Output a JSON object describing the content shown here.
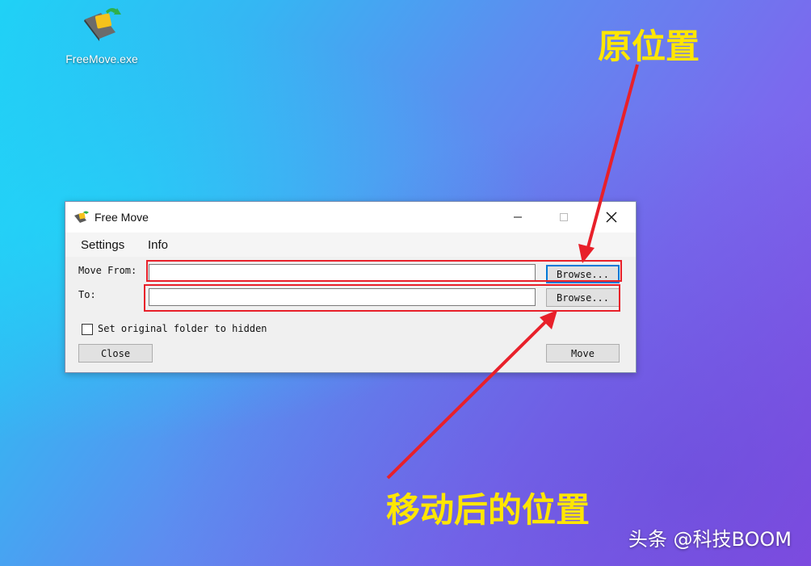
{
  "desktop": {
    "icon_label": "FreeMove.exe"
  },
  "window": {
    "title": "Free Move",
    "menu": [
      "Settings",
      "Info"
    ],
    "move_from_label": "Move From:",
    "move_from_value": "",
    "to_label": "To:",
    "to_value": "",
    "browse_label": "Browse...",
    "checkbox_label": "Set original folder to hidden",
    "checkbox_checked": false,
    "close_label": "Close",
    "move_label": "Move"
  },
  "annotations": {
    "original_location": "原位置",
    "moved_location": "移动后的位置",
    "highlight_color": "#e8202a",
    "text_color": "#ffe600"
  },
  "watermark": "头条 @科技BOOM"
}
